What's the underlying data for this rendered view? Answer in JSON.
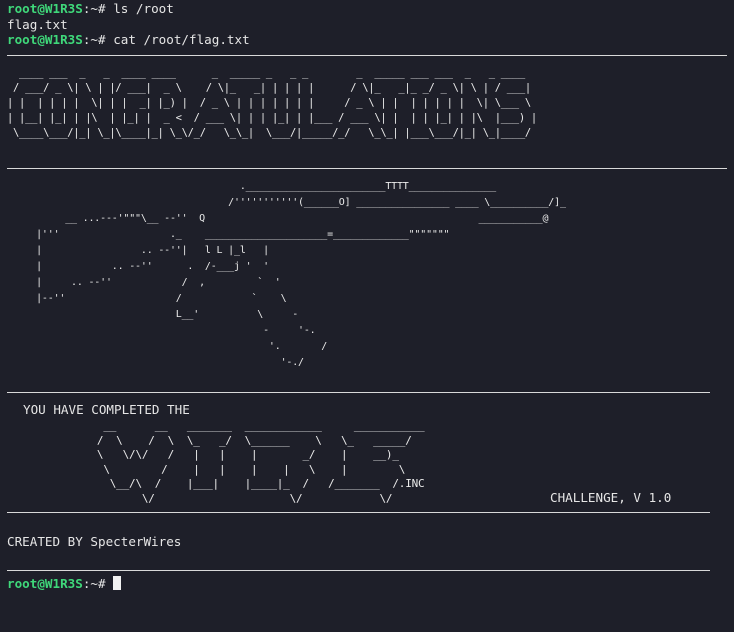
{
  "prompt": {
    "user_host": "root@W1R3S",
    "path": ":~",
    "symbol": "#"
  },
  "commands": [
    {
      "cmd": "ls /root",
      "output": "flag.txt"
    },
    {
      "cmd": "cat /root/flag.txt"
    }
  ],
  "banner_art": "  ____ ___  _   _  ____ ____      _  _____ _   _ _        _  _____ ___ ___  _   _ ____  \n / ___/ _ \\| \\ | |/ ___|  _ \\    / \\|_   _| | | | |      / \\|_   _|_ _/ _ \\| \\ | / ___| \n| |  | | | |  \\| | |  _| |_) |  / _ \\ | | | | | | |     / _ \\ | |  | | | | |  \\| \\___ \\ \n| |__| |_| | |\\  | |_| |  _ <  / ___ \\| | | |_| | |___ / ___ \\| |  | | |_| | |\\  |___) |\n \\____\\___/|_| \\_|\\____|_| \\_\\/_/   \\_\\_|  \\___/|_____/_/   \\_\\_| |___\\___/|_| \\_|____/ ",
  "gun_art": "                                        .________________________TTTT_______________\n                                      /'''''''''''(______O] ________________ ____ \\__________/]_\n          __ ...---'\"\"\"\\__ --''  Q                                               ___________@\n     |'''                   ._    _____________________=_____________\"\"\"\"\"\"\"\n     |                 .. --''|   l L |_l   |\n     |            .. --''      .  /-___j '  '\n     |     .. --''            /  ,         `  '\n     |--''                   /            `    \\\n                             L__'          \\     -\n                                            -     '-.\n                                             '.       /\n                                               '-./",
  "completed_text": "YOU HAVE COMPLETED THE",
  "wires_art": "               __      __   _______  ____________     ___________\n              /  \\    /  \\  \\_   _/  \\______    \\   \\_   _____/\n              \\   \\/\\/   /   |   |    |       _/    |    __)_ \n               \\        /    |   |    |    |   \\    |        \\\n                \\__/\\  /    |___|    |____|_  /   /_______  /.INC\n                     \\/                     \\/            \\/",
  "challenge_label": "CHALLENGE, V 1.0",
  "created_by": "CREATED BY SpecterWires"
}
